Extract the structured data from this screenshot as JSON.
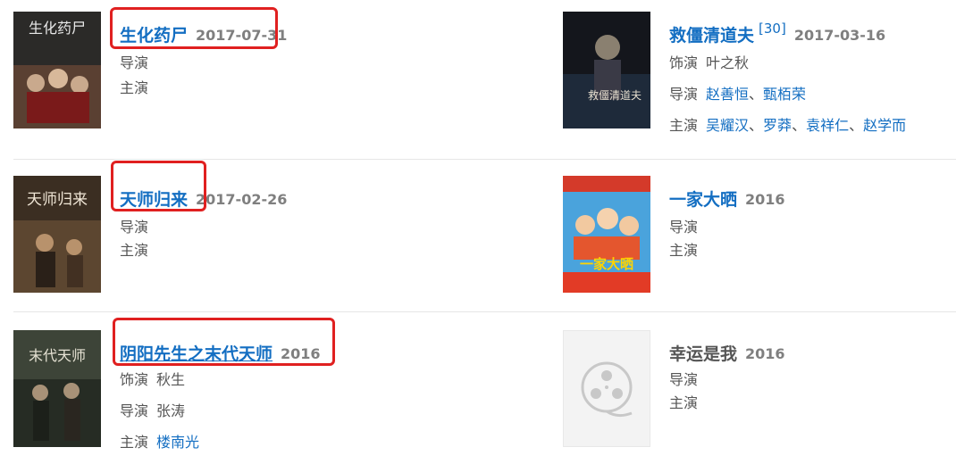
{
  "movies": [
    {
      "title": "生化药尸",
      "date": "2017-07-31",
      "director_label": "导演",
      "cast_label": "主演"
    },
    {
      "title": "救僵清道夫",
      "cite": "[30]",
      "date": "2017-03-16",
      "role_label": "饰演",
      "role": "叶之秋",
      "director_label": "导演",
      "directors": [
        "赵善恒",
        "甄栢荣"
      ],
      "cast_label": "主演",
      "cast": [
        "吴耀汉",
        "罗莽",
        "袁祥仁",
        "赵学而"
      ],
      "sep": "、"
    },
    {
      "title": "天师归来",
      "date": "2017-02-26",
      "director_label": "导演",
      "cast_label": "主演"
    },
    {
      "title": "一家大晒",
      "date": "2016",
      "director_label": "导演",
      "cast_label": "主演"
    },
    {
      "title": "阴阳先生之末代天师",
      "date": "2016",
      "role_label": "饰演",
      "role": "秋生",
      "director_label": "导演",
      "director": "张涛",
      "cast_label": "主演",
      "cast_one": "楼南光"
    },
    {
      "title": "幸运是我",
      "date": "2016",
      "director_label": "导演",
      "cast_label": "主演"
    }
  ],
  "poster_texts": {
    "p1": "生化药尸",
    "p2": "救僵清道夫",
    "p3": "天师归来",
    "p4": "一家大晒",
    "p5": "末代天师"
  },
  "colors": {
    "link": "#136ec2",
    "highlight": "#e02020",
    "date": "#7f7f7f"
  },
  "icons": {
    "placeholder": "film-reel-icon"
  }
}
